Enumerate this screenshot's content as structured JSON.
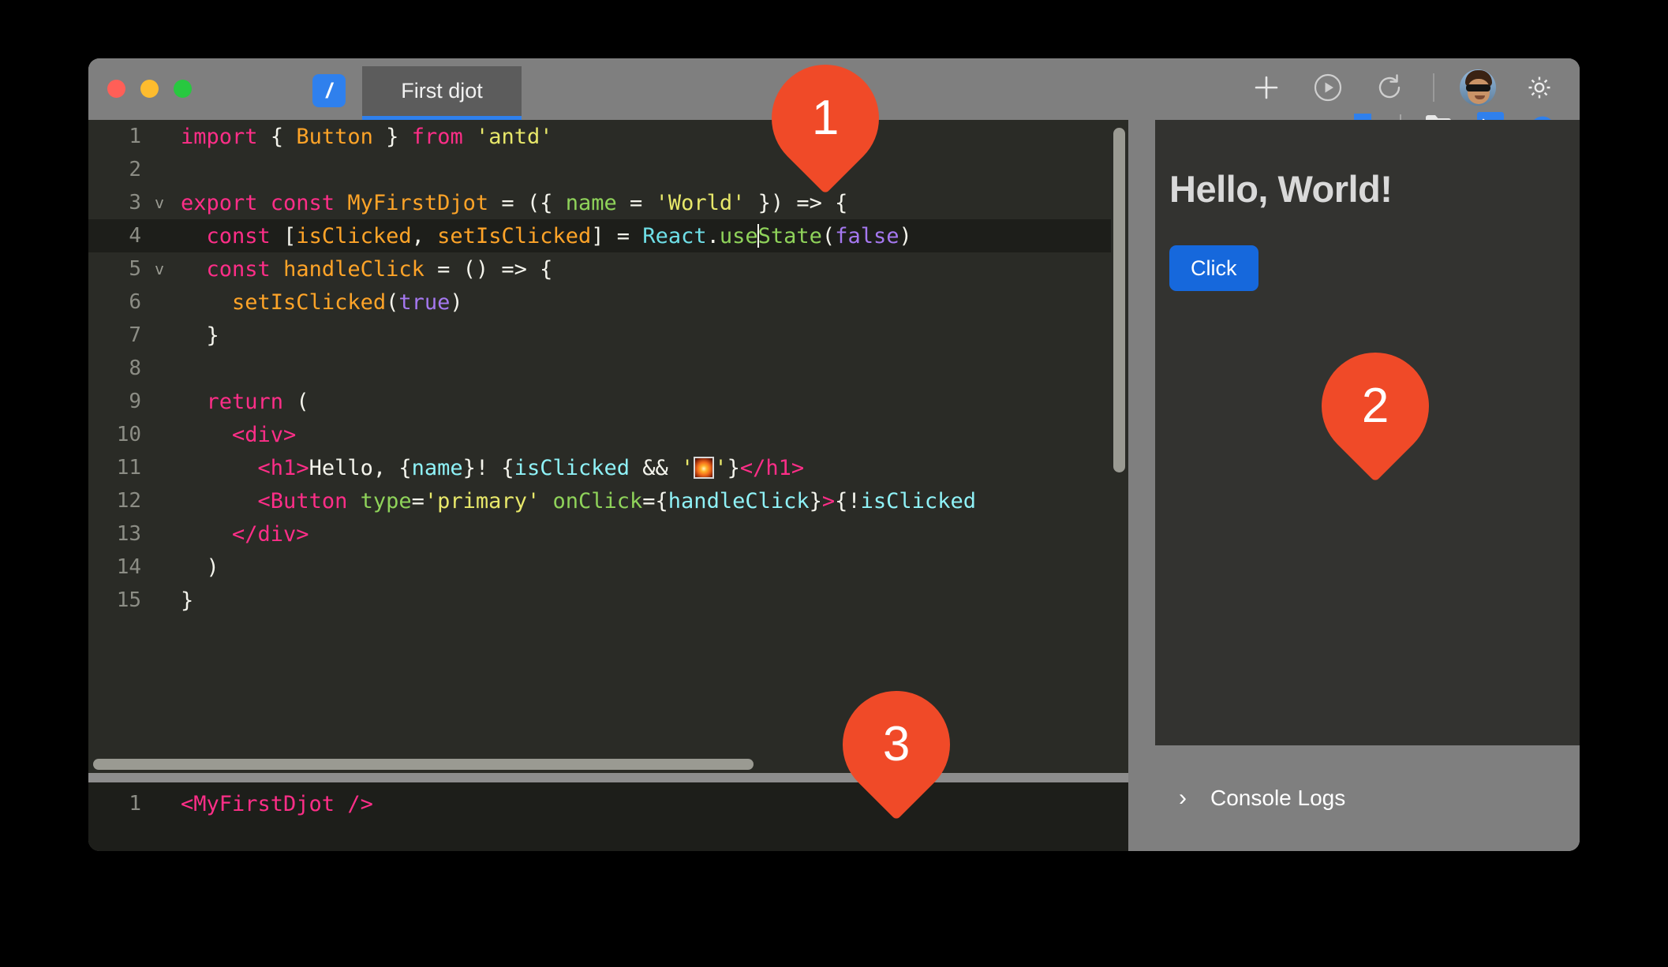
{
  "window": {
    "traffic_lights": [
      "close",
      "minimize",
      "maximize"
    ],
    "app_icon": "/",
    "tab_label": "First djot"
  },
  "toolbar": {
    "row1": [
      {
        "name": "add-button",
        "icon": "plus-icon"
      },
      {
        "name": "run-button",
        "icon": "play-circle-icon"
      },
      {
        "name": "refresh-button",
        "icon": "refresh-icon"
      },
      {
        "name": "toolbar-divider",
        "icon": "divider"
      },
      {
        "name": "user-avatar",
        "icon": "avatar-icon"
      },
      {
        "name": "settings-button",
        "icon": "gear-icon"
      }
    ],
    "row2": [
      {
        "name": "bookmark-button",
        "icon": "bookmark-icon"
      },
      {
        "name": "toolbar-divider-2",
        "icon": "divider"
      },
      {
        "name": "files-button",
        "icon": "folder-icon"
      },
      {
        "name": "terminal-button",
        "icon": "terminal-icon"
      },
      {
        "name": "preview-button",
        "icon": "eye-icon"
      }
    ]
  },
  "editor": {
    "lines": [
      {
        "num": "1",
        "fold": "",
        "active": false
      },
      {
        "num": "2",
        "fold": "",
        "active": false
      },
      {
        "num": "3",
        "fold": "v",
        "active": false
      },
      {
        "num": "4",
        "fold": "",
        "active": true
      },
      {
        "num": "5",
        "fold": "v",
        "active": false
      },
      {
        "num": "6",
        "fold": "",
        "active": false
      },
      {
        "num": "7",
        "fold": "",
        "active": false
      },
      {
        "num": "8",
        "fold": "",
        "active": false
      },
      {
        "num": "9",
        "fold": "",
        "active": false
      },
      {
        "num": "10",
        "fold": "",
        "active": false
      },
      {
        "num": "11",
        "fold": "",
        "active": false
      },
      {
        "num": "12",
        "fold": "",
        "active": false
      },
      {
        "num": "13",
        "fold": "",
        "active": false
      },
      {
        "num": "14",
        "fold": "",
        "active": false
      },
      {
        "num": "15",
        "fold": "",
        "active": false
      }
    ],
    "source_text": [
      "import { Button } from 'antd'",
      "",
      "export const MyFirstDjot = ({ name = 'World' }) => {",
      "  const [isClicked, setIsClicked] = React.useState(false)",
      "  const handleClick = () => {",
      "    setIsClicked(true)",
      "  }",
      "",
      "  return (",
      "    <div>",
      "      <h1>Hello, {name}! {isClicked && '🎆'}</h1>",
      "      <Button type='primary' onClick={handleClick}>{!isClicked",
      "    </div>",
      "  )",
      "}"
    ],
    "cursor_line": "4",
    "cursor_after": "React.use"
  },
  "bottom_editor": {
    "line_number": "1",
    "source_text": "<MyFirstDjot />"
  },
  "preview": {
    "heading": "Hello, World!",
    "button_label": "Click",
    "console_label": "Console Logs",
    "console_chevron": "›"
  },
  "markers": [
    {
      "label": "1"
    },
    {
      "label": "2"
    },
    {
      "label": "3"
    }
  ],
  "colors": {
    "accent_blue": "#2f80ed",
    "button_blue": "#1668dc",
    "marker_orange": "#f04a28",
    "editor_bg": "#2a2b26",
    "active_line_bg": "#1d1e1a",
    "chrome_gray": "#7f7f7f",
    "preview_bg": "#333330"
  }
}
